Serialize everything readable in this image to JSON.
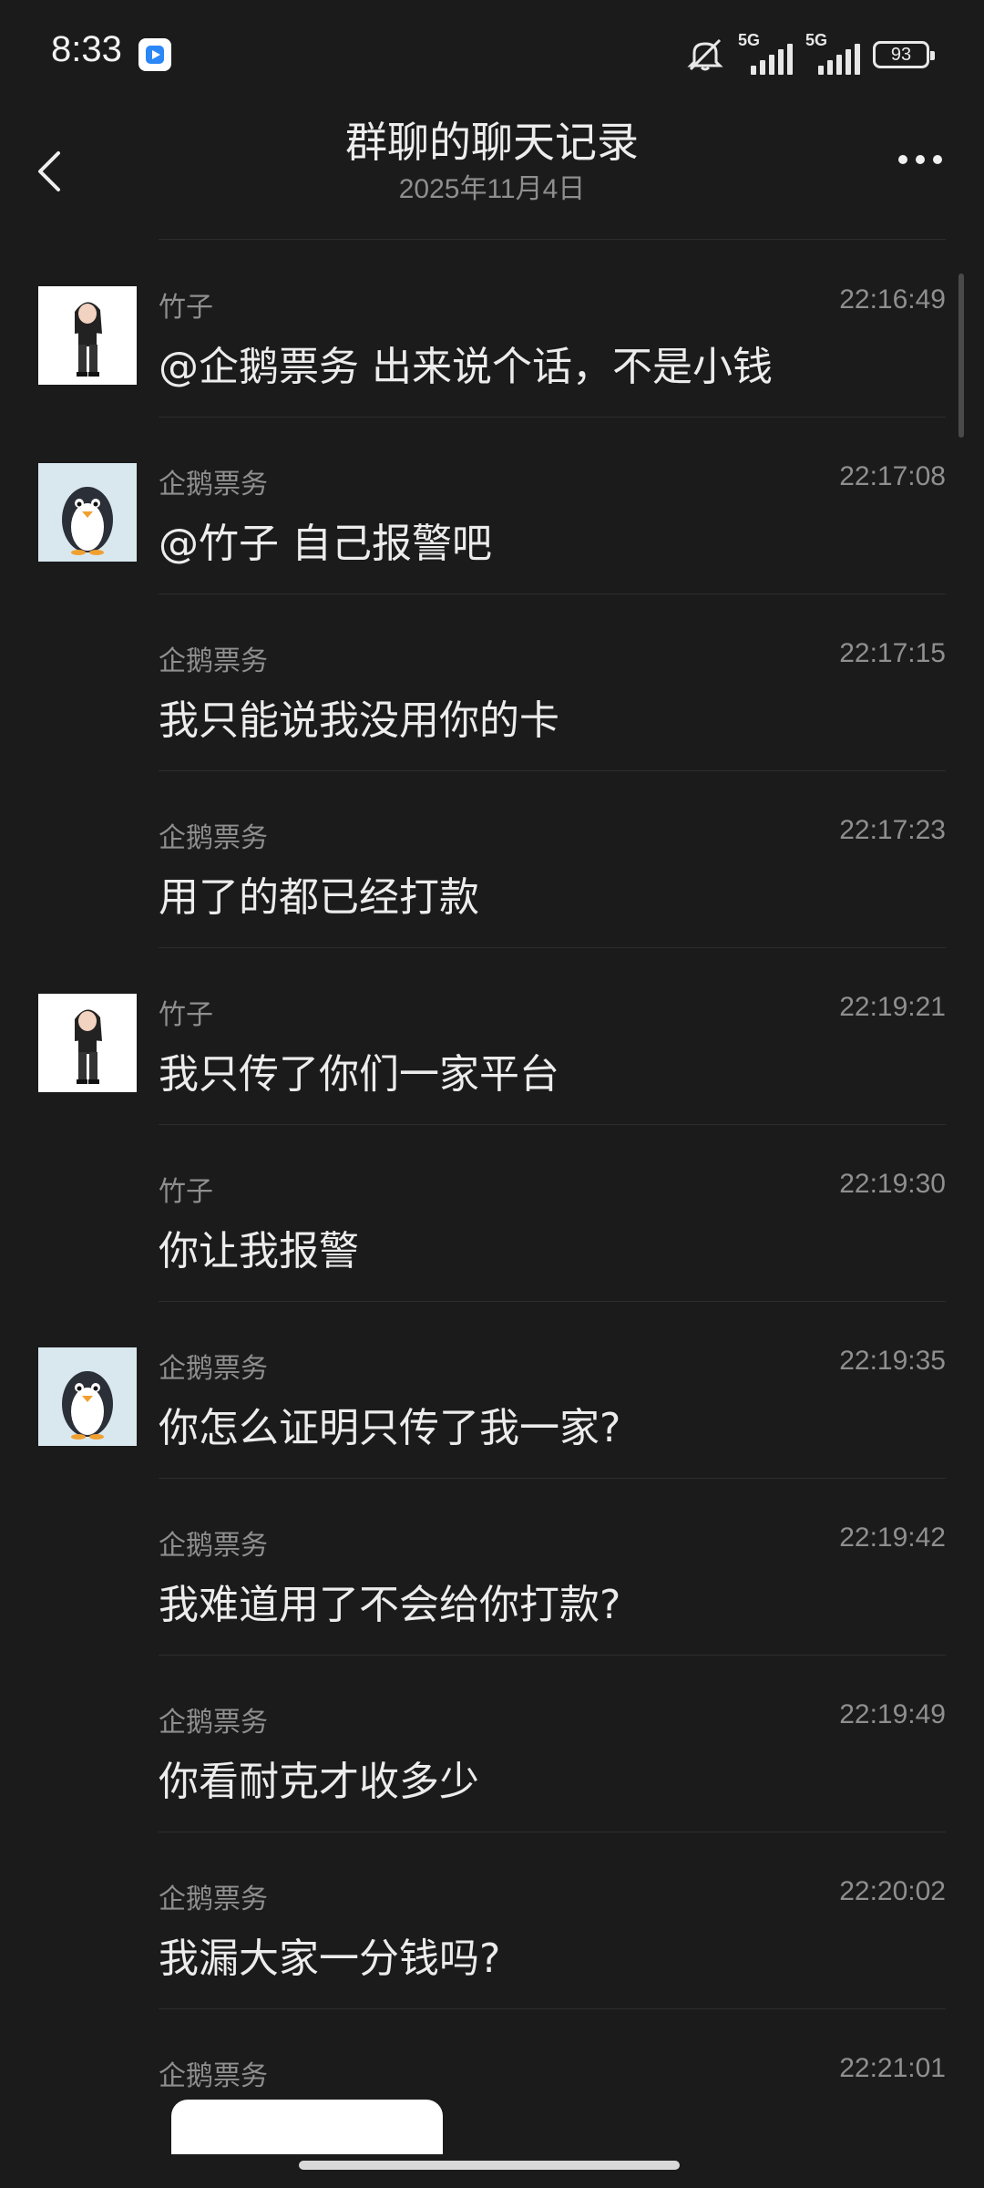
{
  "status_bar": {
    "time": "8:33",
    "signal_label_1": "5G",
    "signal_label_2": "5G",
    "battery": "93"
  },
  "header": {
    "title": "群聊的聊天记录",
    "date": "2025年11月4日"
  },
  "messages": [
    {
      "sender": "竹子",
      "time": "22:16:49",
      "text": "@企鹅票务 出来说个话，不是小钱",
      "avatar": "girl"
    },
    {
      "sender": "企鹅票务",
      "time": "22:17:08",
      "text": "@竹子 自己报警吧",
      "avatar": "penguin"
    },
    {
      "sender": "企鹅票务",
      "time": "22:17:15",
      "text": "我只能说我没用你的卡",
      "avatar": ""
    },
    {
      "sender": "企鹅票务",
      "time": "22:17:23",
      "text": "用了的都已经打款",
      "avatar": ""
    },
    {
      "sender": "竹子",
      "time": "22:19:21",
      "text": "我只传了你们一家平台",
      "avatar": "girl"
    },
    {
      "sender": "竹子",
      "time": "22:19:30",
      "text": "你让我报警",
      "avatar": ""
    },
    {
      "sender": "企鹅票务",
      "time": "22:19:35",
      "text": "你怎么证明只传了我一家?",
      "avatar": "penguin"
    },
    {
      "sender": "企鹅票务",
      "time": "22:19:42",
      "text": "我难道用了不会给你打款?",
      "avatar": ""
    },
    {
      "sender": "企鹅票务",
      "time": "22:19:49",
      "text": "你看耐克才收多少",
      "avatar": ""
    },
    {
      "sender": "企鹅票务",
      "time": "22:20:02",
      "text": "我漏大家一分钱吗?",
      "avatar": ""
    },
    {
      "sender": "企鹅票务",
      "time": "22:21:01",
      "text": "",
      "avatar": ""
    }
  ]
}
